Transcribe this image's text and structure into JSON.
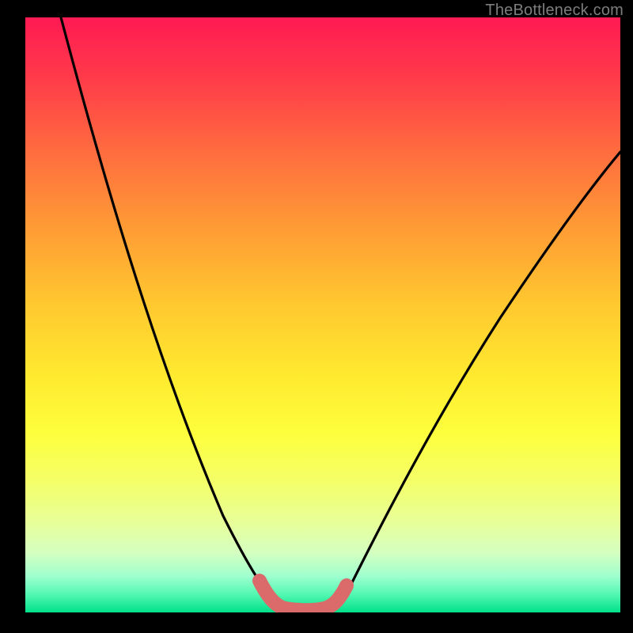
{
  "watermark": {
    "text": "TheBottleneck.com"
  },
  "colors": {
    "background": "#000000",
    "curve_stroke": "#000000",
    "highlight_stroke": "#db6b6b",
    "gradient_top": "#ff1a53",
    "gradient_bottom": "#00e18a"
  },
  "chart_data": {
    "type": "line",
    "title": "",
    "xlabel": "",
    "ylabel": "",
    "xlim": [
      0,
      100
    ],
    "ylim": [
      0,
      100
    ],
    "grid": false,
    "series": [
      {
        "name": "bottleneck-curve",
        "x": [
          6,
          10,
          14,
          18,
          22,
          26,
          30,
          34,
          37,
          39,
          41,
          43,
          45,
          47,
          49,
          51,
          53,
          55,
          60,
          65,
          70,
          75,
          80,
          85,
          90,
          95,
          100
        ],
        "y": [
          100,
          88,
          76,
          65,
          54,
          44,
          34,
          24,
          15,
          10,
          6,
          3,
          1.2,
          0.5,
          0.3,
          0.5,
          1.4,
          3,
          9,
          17,
          25,
          33,
          40,
          47,
          53,
          59,
          64
        ]
      }
    ],
    "annotations": [
      {
        "name": "flat-minimum-highlight",
        "x_range": [
          41,
          53
        ],
        "y": 0.8,
        "note": "thick pink segment marking the bottleneck-free region"
      }
    ],
    "background": "vertical rainbow gradient red→yellow→green inside black frame"
  }
}
